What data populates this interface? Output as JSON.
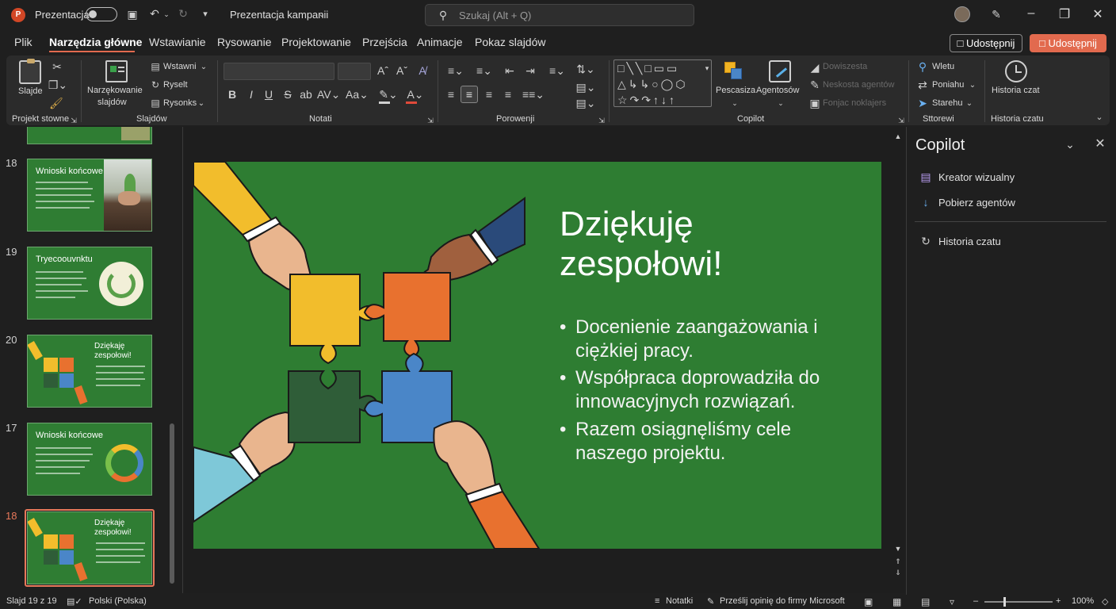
{
  "titlebar": {
    "autosave_label": "Prezentacja",
    "filename": "Prezentacja kampanii",
    "search_placeholder": "Szukaj (Alt + Q)"
  },
  "menu": {
    "tabs": [
      "Plik",
      "Narzędzia główne",
      "Wstawianie",
      "Rysowanie",
      "Projektowanie",
      "Przejścia",
      "Animacje",
      "Pokaz slajdów"
    ],
    "share_outline": "Udostępnij",
    "share_primary": "Udostępnij"
  },
  "ribbon": {
    "slides_btn": "Slajde",
    "new_slide_line1": "Narzękowanie",
    "new_slide_line2": "slajdów",
    "insert_dd": "Wstawni",
    "reset_btn": "Ryselt",
    "section_dd": "Rysonks",
    "drawing_btn": "Pescasiza",
    "agents_btn": "Agentosów",
    "dim1": "Dowiszesta",
    "dim2": "Neskosta agentów",
    "dim3": "Fonjac noklajers",
    "find_btn": "Wletu",
    "replace_btn": "Poniahu",
    "select_btn": "Starehu",
    "history_btn": "Historia czat",
    "groups": {
      "g1": "Projekt stowne",
      "g2": "Slajdów",
      "g3": "Notati",
      "g4": "Porowenji",
      "g5": "Copilot",
      "g6": "Sttorewi",
      "g7": "Historia czatu"
    }
  },
  "thumbnails": [
    {
      "num": "18",
      "title": "Wnioski końcowe",
      "art": "plant"
    },
    {
      "num": "19",
      "title": "Tryecoouvnktu",
      "art": "recycle"
    },
    {
      "num": "20",
      "title": "Dziękaję zespołowi!",
      "art": "puzzle"
    },
    {
      "num": "17",
      "title": "Wnioski końcowe",
      "art": "ring"
    },
    {
      "num": "18",
      "title": "Dziękaję zespołowi!",
      "art": "puzzle",
      "selected": true
    }
  ],
  "slide": {
    "title_line1": "Dziękuję",
    "title_line2": "zespołowi!",
    "bullets": [
      {
        "l1": "Docenienie zaangażowania i",
        "l2": "ciężkiej pracy."
      },
      {
        "l1": "Współpraca doprowadziła do",
        "l2": "innowacyjnych rozwiązań."
      },
      {
        "l1": "Razem osiągnęliśmy cele",
        "l2": "naszego projektu."
      }
    ],
    "bullet_char": "•"
  },
  "copilot": {
    "title": "Copilot",
    "items": [
      "Kreator wizualny",
      "Pobierz agentów",
      "Historia czatu"
    ]
  },
  "status": {
    "slide_info": "Slajd 19 z 19",
    "language": "Polski (Polska)",
    "notes": "Notatki",
    "feedback": "Prześlij opinię do firmy Microsoft",
    "zoom": "100%"
  },
  "colors": {
    "accent": "#e26a4e",
    "slide_green": "#2e7d32",
    "puzzle_yellow": "#f2bd2c",
    "puzzle_orange": "#e8712f",
    "puzzle_darkgreen": "#2f5d38",
    "puzzle_blue": "#4a86c8"
  }
}
